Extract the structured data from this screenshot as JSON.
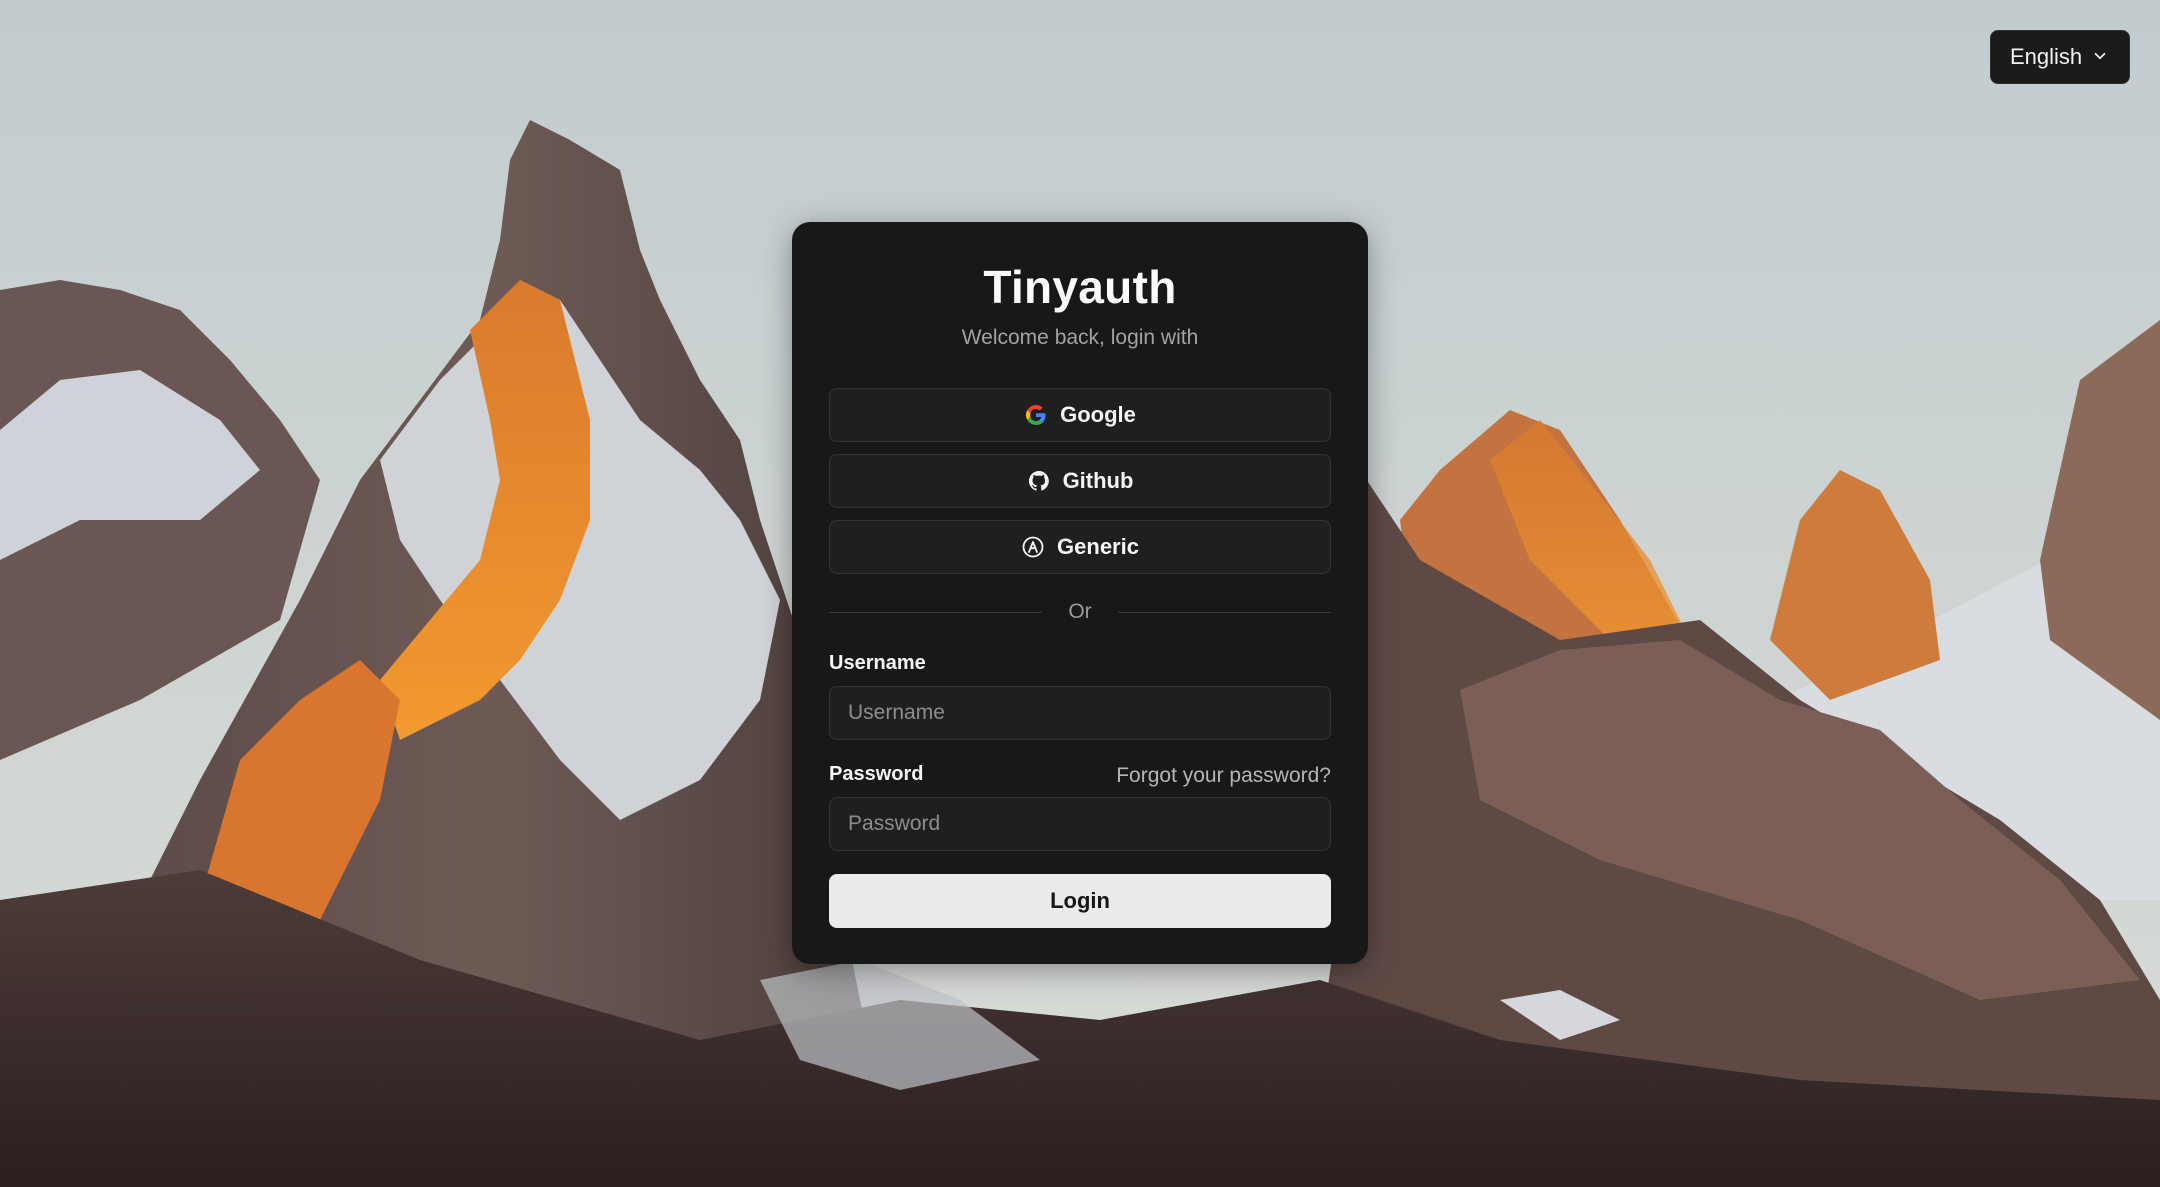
{
  "language_selector": {
    "label": "English",
    "icon": "chevron-down-icon"
  },
  "card": {
    "title": "Tinyauth",
    "subtitle": "Welcome back, login with"
  },
  "oauth_buttons": [
    {
      "label": "Google",
      "icon": "google-icon"
    },
    {
      "label": "Github",
      "icon": "github-icon"
    },
    {
      "label": "Generic",
      "icon": "generic-oauth-icon"
    }
  ],
  "divider_text": "Or",
  "form": {
    "username_label": "Username",
    "username_placeholder": "Username",
    "password_label": "Password",
    "password_placeholder": "Password",
    "forgot_link": "Forgot your password?",
    "login_label": "Login"
  },
  "colors": {
    "card_bg": "#181818",
    "button_bg": "#1f1f1f",
    "login_bg": "#ebebeb"
  }
}
